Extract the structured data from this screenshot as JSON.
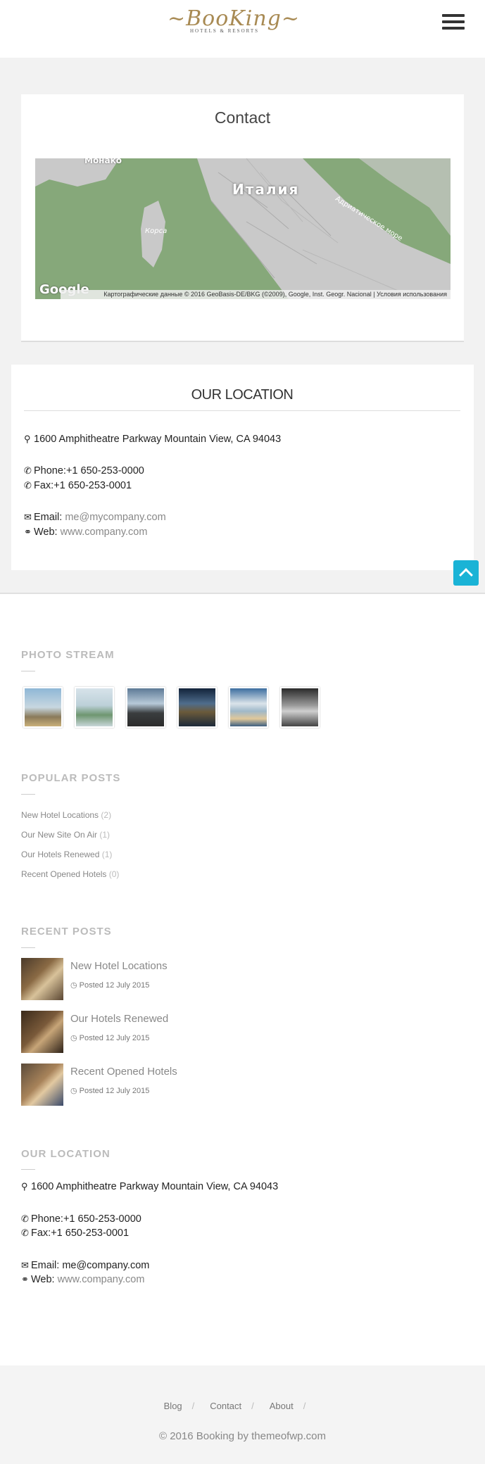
{
  "header": {
    "logo_text": "~BooKing~",
    "logo_tagline": "HOTELS & RESORTS",
    "menu_icon": "hamburger-icon"
  },
  "contact": {
    "title": "Contact",
    "map": {
      "label_country": "Италия",
      "label_city": "Монако",
      "label_island": "Корса",
      "label_sea": "Адриатическое море",
      "brand": "Google",
      "attribution": "Картографические данные © 2016 GeoBasis-DE/BKG (©2009), Google, Inst. Geogr. Nacional   |   Условия использования"
    }
  },
  "location_card": {
    "title": "OUR LOCATION",
    "address": "1600 Amphitheatre Parkway Mountain View, CA 94043",
    "phone": "Phone:+1 650-253-0000",
    "fax": "Fax:+1 650-253-0001",
    "email_label": "Email:",
    "email_value": "me@mycompany.com",
    "web_label": "Web:",
    "web_value": "www.company.com"
  },
  "photo_stream": {
    "title": "PHOTO STREAM",
    "photos": [
      "beach-sunset",
      "green-shore",
      "dark-lake",
      "mountain-lake",
      "sky-reflection",
      "grey-bay"
    ]
  },
  "popular_posts": {
    "title": "POPULAR POSTS",
    "items": [
      {
        "label": "New Hotel Locations",
        "count": "(2)"
      },
      {
        "label": "Our New Site On Air",
        "count": "(1)"
      },
      {
        "label": "Our Hotels Renewed",
        "count": "(1)"
      },
      {
        "label": "Recent Opened Hotels",
        "count": "(0)"
      }
    ]
  },
  "recent_posts": {
    "title": "RECENT POSTS",
    "items": [
      {
        "title": "New Hotel Locations",
        "date": "Posted 12 July 2015"
      },
      {
        "title": "Our Hotels Renewed",
        "date": "Posted 12 July 2015"
      },
      {
        "title": "Recent Opened Hotels",
        "date": "Posted 12 July 2015"
      }
    ]
  },
  "footer_location": {
    "title": "OUR LOCATION",
    "address": "1600 Amphitheatre Parkway Mountain View, CA 94043",
    "phone": "Phone:+1 650-253-0000",
    "fax": "Fax:+1 650-253-0001",
    "email": "Email: me@company.com",
    "web_label": "Web:",
    "web_value": "www.company.com"
  },
  "footer": {
    "nav": [
      "Blog",
      "Contact",
      "About"
    ],
    "separator": "/",
    "copyright": "© 2016 Booking by themeofwp.com"
  },
  "colors": {
    "accent": "#1ab3d6",
    "logo_gold": "#a88a53",
    "map_green": "#86a87a"
  }
}
